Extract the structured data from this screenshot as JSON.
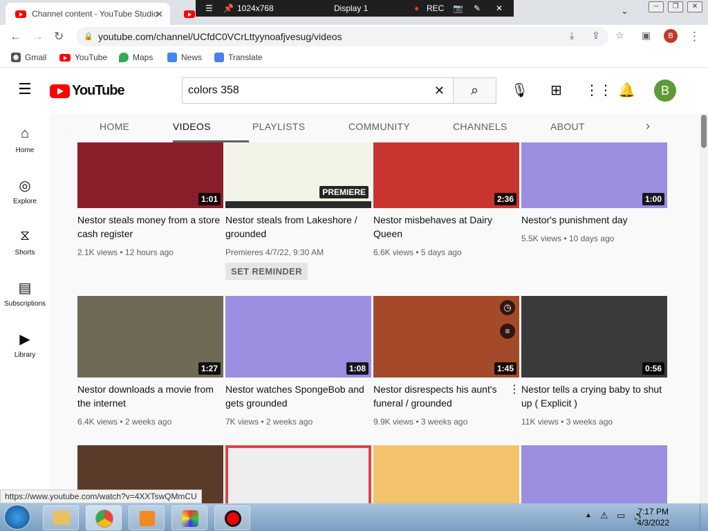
{
  "browser": {
    "tabs": [
      {
        "label": "Channel content - YouTube Studio"
      },
      {
        "label": ""
      }
    ],
    "recorder": {
      "resolution": "1024x768",
      "display": "Display 1",
      "rec": "REC"
    },
    "url": "youtube.com/channel/UCfdC0VCrLttyynoafjvesug/videos",
    "profile_initial": "B",
    "bookmarks": [
      "Gmail",
      "YouTube",
      "Maps",
      "News",
      "Translate"
    ]
  },
  "youtube": {
    "logo": "YouTube",
    "search_value": "colors 358",
    "avatar_initial": "B",
    "guide": [
      "Home",
      "Explore",
      "Shorts",
      "Subscriptions",
      "Library"
    ],
    "channel_tabs": [
      "HOME",
      "VIDEOS",
      "PLAYLISTS",
      "COMMUNITY",
      "CHANNELS",
      "ABOUT"
    ],
    "videos": [
      {
        "title": "Nestor steals money from a store cash register",
        "views": "2.1K views",
        "age": "12 hours ago",
        "duration": "1:01"
      },
      {
        "title": "Nestor steals from Lakeshore / grounded",
        "views": "Premieres 4/7/22, 9:30 AM",
        "age": "",
        "duration": "PREMIERE",
        "reminder": "SET REMINDER"
      },
      {
        "title": "Nestor misbehaves at Dairy Queen",
        "views": "6.6K views",
        "age": "5 days ago",
        "duration": "2:36"
      },
      {
        "title": "Nestor's punishment day",
        "views": "5.5K views",
        "age": "10 days ago",
        "duration": "1:00"
      },
      {
        "title": "Nestor downloads a movie from the internet",
        "views": "6.4K views",
        "age": "2 weeks ago",
        "duration": "1:27"
      },
      {
        "title": "Nestor watches SpongeBob and gets grounded",
        "views": "7K views",
        "age": "2 weeks ago",
        "duration": "1:08"
      },
      {
        "title": "Nestor disrespects his aunt's funeral / grounded",
        "views": "9.9K views",
        "age": "3 weeks ago",
        "duration": "1:45"
      },
      {
        "title": "Nestor tells a crying baby to shut up ( Explicit )",
        "views": "11K views",
        "age": "3 weeks ago",
        "duration": "0:56"
      }
    ],
    "thumb_colors": [
      "#8b1e2b",
      "#f2f2e6",
      "#c8342f",
      "#9b8ee0",
      "#6f6a56",
      "#9b8ee0",
      "#a44a2a",
      "#3a3a3a",
      "#5a3b2a",
      "#eeeeee",
      "#f2c36a",
      "#9b8ee0"
    ]
  },
  "status_url": "https://www.youtube.com/watch?v=4XXTswQMmCU",
  "taskbar": {
    "time": "7:17 PM",
    "date": "4/3/2022"
  }
}
